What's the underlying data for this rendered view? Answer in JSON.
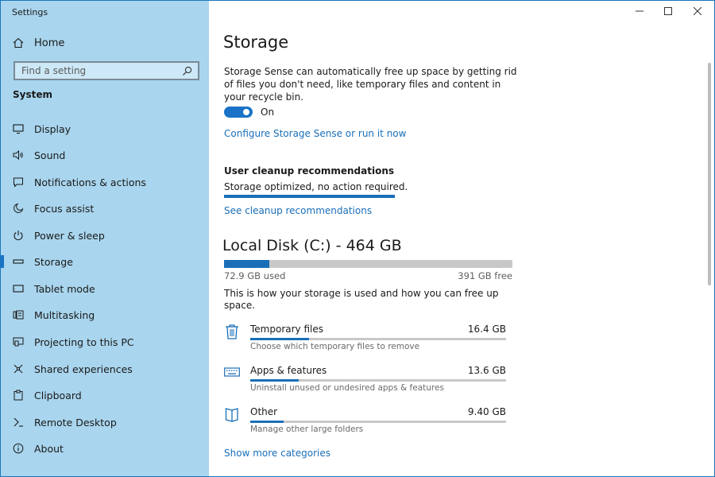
{
  "window": {
    "title": "Settings"
  },
  "sidebar": {
    "home_label": "Home",
    "search": {
      "placeholder": "Find a setting"
    },
    "section": "System",
    "items": [
      {
        "label": "Display",
        "icon": "monitor-icon"
      },
      {
        "label": "Sound",
        "icon": "speaker-icon"
      },
      {
        "label": "Notifications & actions",
        "icon": "notification-icon"
      },
      {
        "label": "Focus assist",
        "icon": "moon-icon"
      },
      {
        "label": "Power & sleep",
        "icon": "power-icon"
      },
      {
        "label": "Storage",
        "icon": "storage-icon",
        "active": true
      },
      {
        "label": "Tablet mode",
        "icon": "tablet-icon"
      },
      {
        "label": "Multitasking",
        "icon": "multitasking-icon"
      },
      {
        "label": "Projecting to this PC",
        "icon": "projector-icon"
      },
      {
        "label": "Shared experiences",
        "icon": "shared-icon"
      },
      {
        "label": "Clipboard",
        "icon": "clipboard-icon"
      },
      {
        "label": "Remote Desktop",
        "icon": "remote-icon"
      },
      {
        "label": "About",
        "icon": "info-icon"
      }
    ]
  },
  "main": {
    "title": "Storage",
    "storage_sense_desc": "Storage Sense can automatically free up space by getting rid of files you don't need, like temporary files and content in your recycle bin.",
    "toggle_state": "On",
    "configure_link": "Configure Storage Sense or run it now",
    "cleanup": {
      "heading": "User cleanup recommendations",
      "status": "Storage optimized, no action required.",
      "link": "See cleanup recommendations"
    },
    "disk": {
      "title": "Local Disk (C:) - 464 GB",
      "used": "72.9 GB used",
      "free": "391 GB free",
      "used_fraction": 0.157,
      "description": "This is how your storage is used and how you can free up space."
    },
    "categories": [
      {
        "name": "Temporary files",
        "size": "16.4 GB",
        "desc": "Choose which temporary files to remove",
        "fraction": 0.23,
        "icon": "trash-icon"
      },
      {
        "name": "Apps & features",
        "size": "13.6 GB",
        "desc": "Uninstall unused or undesired apps & features",
        "fraction": 0.19,
        "icon": "keyboard-icon"
      },
      {
        "name": "Other",
        "size": "9.40 GB",
        "desc": "Manage other large folders",
        "fraction": 0.13,
        "icon": "folder-icon"
      }
    ],
    "show_more_link": "Show more categories"
  },
  "colors": {
    "accent": "#1a73c8",
    "sidebar_bg": "#a9d5ee"
  }
}
